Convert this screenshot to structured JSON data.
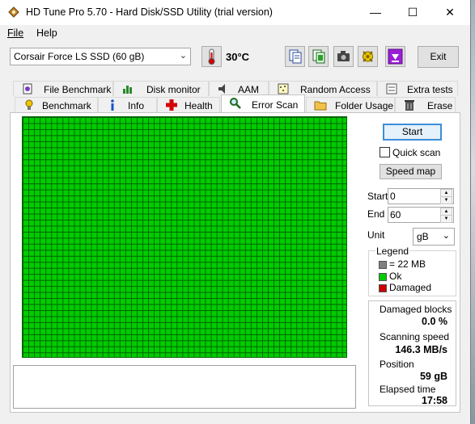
{
  "window": {
    "title": "HD Tune Pro 5.70 - Hard Disk/SSD Utility (trial version)",
    "min_glyph": "—",
    "max_glyph": "☐",
    "close_glyph": "✕"
  },
  "menu": {
    "file": "File",
    "help": "Help"
  },
  "toolbar": {
    "drive": "Corsair Force LS SSD (60 gB)",
    "temperature": "30°C",
    "exit": "Exit",
    "icons": [
      "copy-text-icon",
      "copy-screen-icon",
      "camera-icon",
      "options-icon",
      "save-down-icon"
    ]
  },
  "tabs": {
    "top": [
      "File Benchmark",
      "Disk monitor",
      "AAM",
      "Random Access",
      "Extra tests"
    ],
    "bottom": [
      "Benchmark",
      "Info",
      "Health",
      "Error Scan",
      "Folder Usage",
      "Erase"
    ],
    "active": "Error Scan"
  },
  "scan": {
    "start_button": "Start",
    "quick_scan_label": "Quick scan",
    "quick_scan_checked": false,
    "speed_map_button": "Speed map",
    "start_label": "Start",
    "start_value": "0",
    "end_label": "End",
    "end_value": "60",
    "unit_label": "Unit",
    "unit_value": "gB"
  },
  "legend": {
    "title": "Legend",
    "block": "= 22 MB",
    "ok": "Ok",
    "damaged": "Damaged",
    "block_color": "#808080",
    "ok_color": "#00cc00",
    "damaged_color": "#cc0000"
  },
  "stats": {
    "damaged_label": "Damaged blocks",
    "damaged_value": "0.0 %",
    "speed_label": "Scanning speed",
    "speed_value": "146.3 MB/s",
    "position_label": "Position",
    "position_value": "59 gB",
    "elapsed_label": "Elapsed time",
    "elapsed_value": "17:58"
  }
}
